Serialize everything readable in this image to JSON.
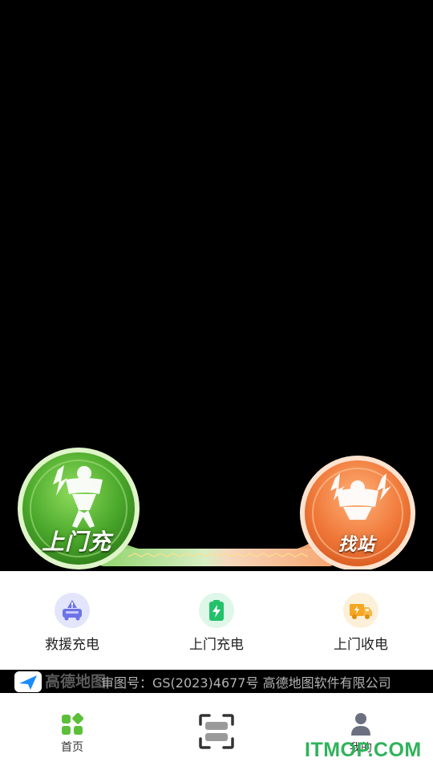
{
  "banner": {
    "left_label": "上门充",
    "right_label": "找站",
    "left_color": "#4fae2c",
    "right_color": "#f08a45"
  },
  "services": [
    {
      "label": "救援充电",
      "icon": "rescue-car-icon",
      "color": "#6d73e8"
    },
    {
      "label": "上门充电",
      "icon": "battery-charge-icon",
      "color": "#22c26a"
    },
    {
      "label": "上门收电",
      "icon": "delivery-truck-icon",
      "color": "#f5a623"
    }
  ],
  "map_footer": {
    "logo_text": "高德地图",
    "approval": "审图号：GS(2023)4677号 高德地图软件有限公司"
  },
  "tabs": [
    {
      "label": "首页",
      "icon": "home-grid-icon",
      "active_color": "#5cbf3a"
    },
    {
      "label": "",
      "icon": "scan-icon"
    },
    {
      "label": "我的",
      "icon": "user-icon"
    }
  ],
  "watermark": "ITMOP.COM"
}
